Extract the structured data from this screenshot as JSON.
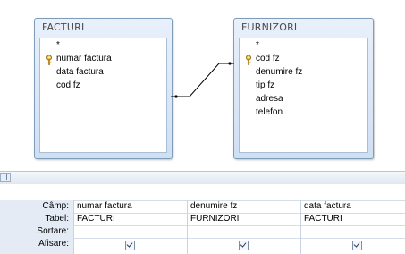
{
  "tables": {
    "facturi": {
      "title": "FACTURI",
      "fields": [
        "*",
        "numar factura",
        "data factura",
        "cod fz"
      ],
      "key_field": "numar factura"
    },
    "furnizori": {
      "title": "FURNIZORI",
      "fields": [
        "*",
        "cod fz",
        "denumire fz",
        "tip fz",
        "adresa",
        "telefon"
      ],
      "key_field": "cod fz"
    }
  },
  "query_grid": {
    "row_labels": [
      "Câmp:",
      "Tabel:",
      "Sortare:",
      "Afisare:"
    ],
    "columns": [
      {
        "field": "numar factura",
        "table": "FACTURI",
        "sort": "",
        "show": true
      },
      {
        "field": "denumire fz",
        "table": "FURNIZORI",
        "sort": "",
        "show": true
      },
      {
        "field": "data factura",
        "table": "FACTURI",
        "sort": "",
        "show": true
      }
    ]
  },
  "icons": {
    "primary_key": "key-icon",
    "splitter": "splitter-handle-icon"
  },
  "colors": {
    "table_header": "#cfdff3",
    "border": "#7f9db9",
    "grid_label_bg": "#e4ebf5"
  }
}
